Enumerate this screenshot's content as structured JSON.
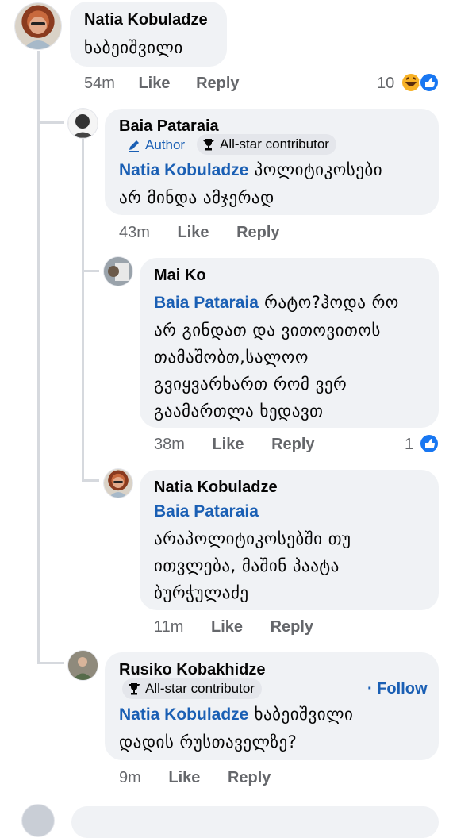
{
  "comments": [
    {
      "name": "Natia Kobuladze",
      "text": "ხაბეიშვილი",
      "time": "54m",
      "like": "Like",
      "reply": "Reply",
      "reactions": "10"
    },
    {
      "name": "Baia Pataraia",
      "badges": [
        "Author",
        "All-star contributor"
      ],
      "mention": "Natia Kobuladze",
      "text_line1": "პოლიტიკოსები",
      "text_line2": "არ მინდა ამჯერად",
      "time": "43m",
      "like": "Like",
      "reply": "Reply"
    },
    {
      "name": "Mai Ko",
      "mention": "Baia Pataraia",
      "text_line1": "რატო?ჰოდა რო",
      "text_line2": "არ გინდათ და ვითოვითოს",
      "text_line3": "თამაშობთ,სალოო",
      "text_line4": "გვიყვარხართ  რომ ვერ",
      "text_line5": "გაამართლა ხედავთ",
      "time": "38m",
      "like": "Like",
      "reply": "Reply",
      "reactions": "1"
    },
    {
      "name": "Natia Kobuladze",
      "mention": "Baia Pataraia",
      "text_line1": "არაპოლიტიკოსებში თუ",
      "text_line2": "ითვლება, მაშინ პაატა",
      "text_line3": "ბურჭულაძე",
      "time": "11m",
      "like": "Like",
      "reply": "Reply"
    },
    {
      "name": "Rusiko Kobakhidze",
      "badges": [
        "All-star contributor"
      ],
      "follow": "· Follow",
      "mention": "Natia Kobuladze",
      "text_line1": "ხაბეიშვილი",
      "text_line2": "დადის რუსთაველზე?",
      "time": "9m",
      "like": "Like",
      "reply": "Reply"
    }
  ],
  "colors": {
    "bubble": "#f0f2f5",
    "link": "#1a5fb4",
    "meta": "#65676b",
    "like_blue": "#1877f2",
    "haha_yellow": "#f7b125"
  },
  "icons": [
    "pencil-icon",
    "trophy-icon",
    "like-reaction-icon",
    "haha-reaction-icon"
  ]
}
